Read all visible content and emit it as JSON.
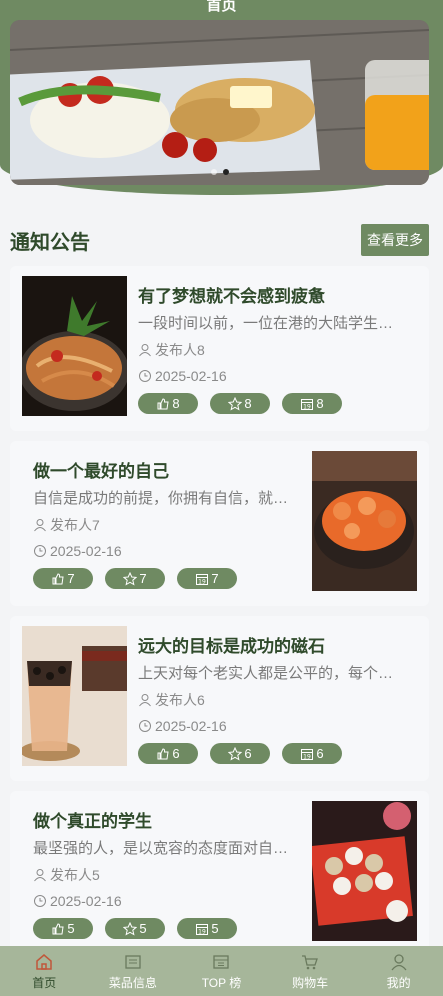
{
  "header": {
    "title": "首页"
  },
  "banner": {
    "dots": 2,
    "active_dot": 1
  },
  "notices": {
    "title": "通知公告",
    "more_label": "查看更多",
    "items": [
      {
        "title": "有了梦想就不会感到疲惫",
        "desc": "一段时间以前，一位在港的大陆学生…",
        "author": "发布人8",
        "date": "2025-02-16",
        "likes": "8",
        "stars": "8",
        "views": "8",
        "image": "noodle-dish"
      },
      {
        "title": "做一个最好的自己",
        "desc": "自信是成功的前提，你拥有自信，就…",
        "author": "发布人7",
        "date": "2025-02-16",
        "likes": "7",
        "stars": "7",
        "views": "7",
        "image": "shrimp-dish"
      },
      {
        "title": "远大的目标是成功的磁石",
        "desc": "上天对每个老实人都是公平的，每个…",
        "author": "发布人6",
        "date": "2025-02-16",
        "likes": "6",
        "stars": "6",
        "views": "6",
        "image": "bubble-tea"
      },
      {
        "title": "做个真正的学生",
        "desc": "最坚强的人，是以宽容的态度面对自…",
        "author": "发布人5",
        "date": "2025-02-16",
        "likes": "5",
        "stars": "5",
        "views": "5",
        "image": "rice-cakes"
      }
    ]
  },
  "tabbar": {
    "items": [
      {
        "label": "首页",
        "icon": "home-icon",
        "active": true
      },
      {
        "label": "菜品信息",
        "icon": "menu-icon",
        "active": false
      },
      {
        "label": "TOP 榜",
        "icon": "ranking-icon",
        "active": false
      },
      {
        "label": "购物车",
        "icon": "cart-icon",
        "active": false
      },
      {
        "label": "我的",
        "icon": "user-icon",
        "active": false
      }
    ]
  },
  "colors": {
    "primary": "#6f8a62",
    "title": "#2f4a2b",
    "tabbar": "#a6b69a"
  }
}
